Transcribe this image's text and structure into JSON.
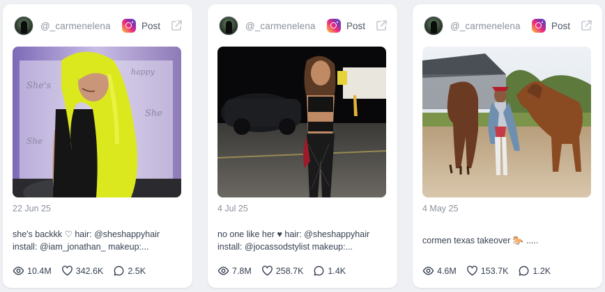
{
  "cards": [
    {
      "handle": "@_carmenelena",
      "post_label": "Post",
      "date": "22 Jun 25",
      "caption_lines": [
        "she's backkk ♡ hair: @sheshappyhair",
        "install: @iam_jonathan_ makeup:..."
      ],
      "stats": {
        "views": "10.4M",
        "likes": "342.6K",
        "comments": "2.5K"
      },
      "image_desc_colors": {
        "backdrop": "#b8a6d6",
        "hair": "#e4ef23",
        "dress": "#111111"
      }
    },
    {
      "handle": "@_carmenelena",
      "post_label": "Post",
      "date": "4 Jul 25",
      "caption_lines": [
        "no one like her ♥ hair: @sheshappyhair",
        "install: @jocassodstylist makeup:..."
      ],
      "stats": {
        "views": "7.8M",
        "likes": "258.7K",
        "comments": "1.4K"
      },
      "image_desc_colors": {
        "sky": "#0a0a0c",
        "ground": "#5c5a55",
        "outfit": "#141414"
      }
    },
    {
      "handle": "@_carmenelena",
      "post_label": "Post",
      "date": "4 May 25",
      "caption_lines": [
        "cormen texas takeover 🐎 ....."
      ],
      "stats": {
        "views": "4.6M",
        "likes": "153.7K",
        "comments": "1.2K"
      },
      "image_desc_colors": {
        "sky": "#dfe6ee",
        "ground": "#c8b394",
        "horse": "#6e3a1e"
      }
    }
  ],
  "colors": {
    "background": "#eef0f4",
    "card": "#ffffff",
    "muted_text": "#8a919c",
    "body_text": "#374151"
  }
}
